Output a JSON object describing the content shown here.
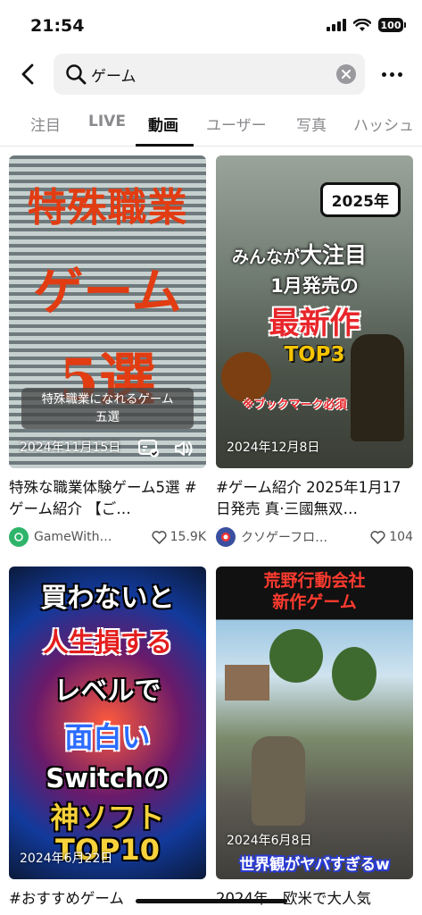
{
  "status": {
    "time": "21:54",
    "battery": "100"
  },
  "search": {
    "query": "ゲーム"
  },
  "tabs": [
    "注目",
    "LIVE",
    "動画",
    "ユーザー",
    "写真",
    "ハッシュ"
  ],
  "videos": [
    {
      "thumb_lines": [
        "特殊職業",
        "ゲーム",
        "5選"
      ],
      "thumb_subtitle": "特殊職業になれるゲーム\n五選",
      "date": "2024年11月15日",
      "caption": "特殊な職業体験ゲーム5選 #ゲーム紹介 【ご…",
      "author": "GameWith…",
      "likes": "15.9K",
      "avatar_color": "#2fb56b"
    },
    {
      "thumb_lines": [
        "2025年",
        "みんなが",
        "大注目",
        "1月発売の",
        "最新作",
        "TOP3",
        "※ブックマーク必須"
      ],
      "date": "2024年12月8日",
      "caption": "#ゲーム紹介 2025年1月17日発売 真·三國無双…",
      "author": "クソゲーフロ…",
      "likes": "104",
      "avatar_color": "#3a4fa0"
    },
    {
      "thumb_lines": [
        "買わないと",
        "人生損する",
        "レベルで",
        "面白い",
        "Switchの",
        "神ソフト",
        "TOP10"
      ],
      "date": "2024年6月22日",
      "caption": "#おすすめゲーム"
    },
    {
      "thumb_lines": [
        "荒野行動会社",
        "新作ゲーム",
        "世界観がヤバすぎるw"
      ],
      "date": "2024年6月8日",
      "caption": "2024年　欧米で大人気"
    }
  ],
  "colors": {
    "accent_red": "#e23c12",
    "tab_inactive": "#8a8a8e"
  }
}
